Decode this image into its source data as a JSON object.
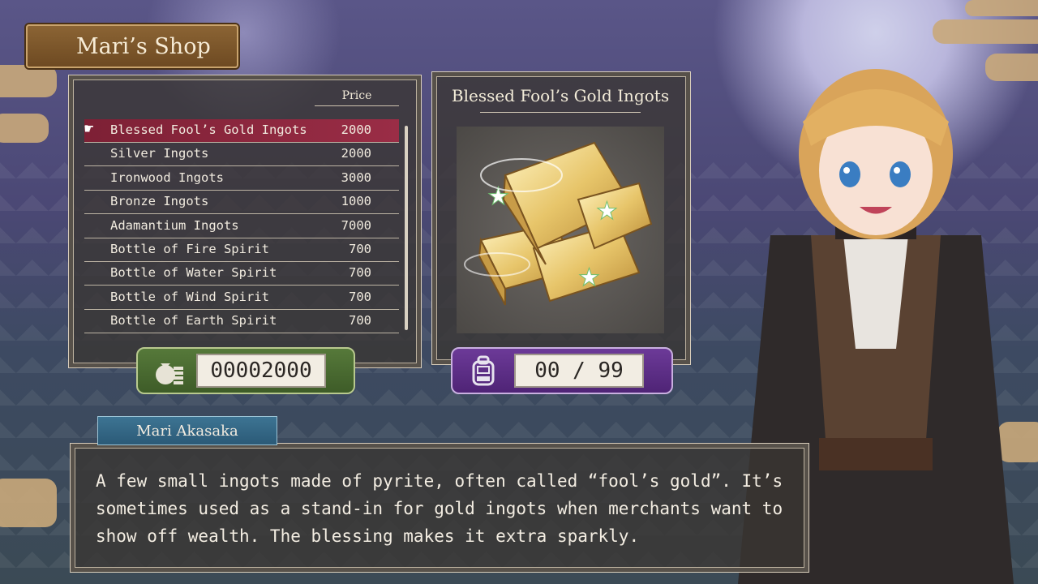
{
  "shop": {
    "title": "Mari’s Shop",
    "price_header": "Price",
    "items": [
      {
        "name": "Blessed Fool’s Gold Ingots",
        "price": "2000",
        "selected": true
      },
      {
        "name": "Silver Ingots",
        "price": "2000"
      },
      {
        "name": "Ironwood Ingots",
        "price": "3000"
      },
      {
        "name": "Bronze Ingots",
        "price": "1000"
      },
      {
        "name": "Adamantium Ingots",
        "price": "7000"
      },
      {
        "name": "Bottle of Fire Spirit",
        "price": "700"
      },
      {
        "name": "Bottle of Water Spirit",
        "price": "700"
      },
      {
        "name": "Bottle of Wind Spirit",
        "price": "700"
      },
      {
        "name": "Bottle of Earth Spirit",
        "price": "700"
      }
    ],
    "money": "00002000",
    "money_icon": "money-bag-icon"
  },
  "detail": {
    "item_title": "Blessed Fool’s Gold Ingots",
    "owned": "00 / 99",
    "inventory_icon": "backpack-icon"
  },
  "dialog": {
    "speaker": "Mari Akasaka",
    "lines": [
      "A few small ingots made of pyrite, often called “fool’s gold”. It’s",
      "sometimes used as a stand-in for gold ingots when merchants want to",
      "show off wealth. The blessing makes it extra sparkly."
    ]
  },
  "colors": {
    "selected_row": "#8f2a42",
    "money_counter": "#4a6a30",
    "inventory_counter": "#5d2e86",
    "name_plate": "#2f6482"
  }
}
